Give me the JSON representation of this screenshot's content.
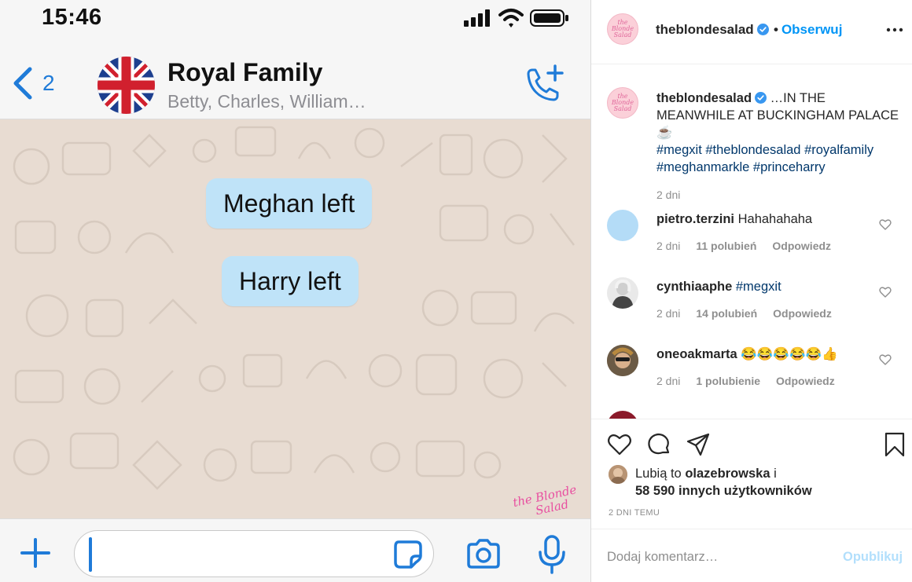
{
  "phone": {
    "status_bar": {
      "time": "15:46"
    },
    "header": {
      "back_count": "2",
      "title": "Royal Family",
      "subtitle": "Betty, Charles, William…"
    },
    "messages": [
      {
        "text": "Meghan left"
      },
      {
        "text": "Harry left"
      }
    ],
    "watermark": "the Blonde Salad",
    "colors": {
      "accent": "#1f7bd8",
      "bubble": "#bfe3f8",
      "wallpaper": "#e8dcd2"
    },
    "icons": [
      "back-chevron-icon",
      "add-call-icon",
      "plus-icon",
      "sticker-icon",
      "camera-icon",
      "microphone-icon"
    ]
  },
  "instagram": {
    "header": {
      "username": "theblondesalad",
      "separator": "•",
      "follow_label": "Obserwuj"
    },
    "caption": {
      "username": "theblondesalad",
      "text": "…IN THE MEANWHILE AT BUCKINGHAM PALACE",
      "emoji": "☕",
      "hashtags": [
        "#megxit",
        "#theblondesalad",
        "#royalfamily",
        "#meghanmarkle",
        "#princeharry"
      ],
      "time": "2 dni"
    },
    "comments": [
      {
        "username": "pietro.terzini",
        "text": "Hahahahaha",
        "time": "2 dni",
        "likes": "11 polubień",
        "reply": "Odpowiedz"
      },
      {
        "username": "cynthiaaphe",
        "text": "#megxit",
        "time": "2 dni",
        "likes": "14 polubień",
        "reply": "Odpowiedz"
      },
      {
        "username": "oneoakmarta",
        "text": "😂😂😂😂😂👍",
        "time": "2 dni",
        "likes": "1 polubienie",
        "reply": "Odpowiedz"
      }
    ],
    "likes": {
      "prefix": "Lubią to",
      "user": "olazebrowska",
      "suffix": "i",
      "others": "58 590 innych użytkowników"
    },
    "post_time": "2 DNI TEMU",
    "add_comment_placeholder": "Dodaj komentarz…",
    "publish_label": "Opublikuj",
    "colors": {
      "link": "#0095f6",
      "hashtag": "#00376b",
      "muted": "#8e8e8e",
      "publish_disabled": "#b2dffc"
    },
    "icons": [
      "verified-badge-icon",
      "more-icon",
      "heart-icon",
      "comment-icon",
      "share-icon",
      "bookmark-icon"
    ]
  }
}
